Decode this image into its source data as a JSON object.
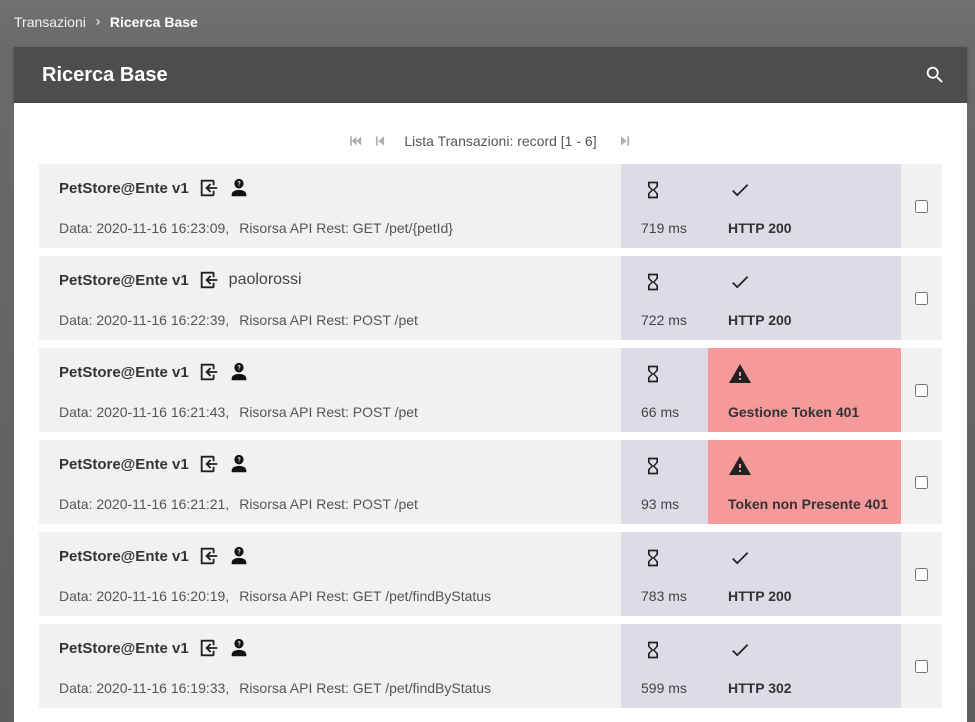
{
  "breadcrumb": {
    "items": [
      {
        "label": "Transazioni"
      },
      {
        "label": "Ricerca Base"
      }
    ]
  },
  "panel": {
    "title": "Ricerca Base",
    "search_icon": "search-icon"
  },
  "pager": {
    "label": "Lista Transazioni: record [1 - 6]",
    "first_icon": "first-page-icon",
    "prev_icon": "prev-page-icon",
    "last_icon": "last-page-icon"
  },
  "colors": {
    "header_bg": "#4d4d4d",
    "row_bg": "#f1f1f1",
    "status_ok_bg": "#dcdce6",
    "status_error_bg": "#f5999b"
  },
  "transactions": [
    {
      "api": "PetStore@Ente v1",
      "principal": "",
      "date": "Data: 2020-11-16 16:23:09,",
      "resource": "Risorsa API Rest: GET /pet/{petId}",
      "latency": "719 ms",
      "status": "HTTP 200",
      "status_type": "ok",
      "direction_icon": "inbound-icon",
      "user_icon": "anonymous-user-icon",
      "status_icon": "check-icon"
    },
    {
      "api": "PetStore@Ente v1",
      "principal": "paolorossi",
      "date": "Data: 2020-11-16 16:22:39,",
      "resource": "Risorsa API Rest: POST /pet",
      "latency": "722 ms",
      "status": "HTTP 200",
      "status_type": "ok",
      "direction_icon": "inbound-icon",
      "user_icon": "",
      "status_icon": "check-icon"
    },
    {
      "api": "PetStore@Ente v1",
      "principal": "",
      "date": "Data: 2020-11-16 16:21:43,",
      "resource": "Risorsa API Rest: POST /pet",
      "latency": "66 ms",
      "status": "Gestione Token 401",
      "status_type": "error",
      "direction_icon": "inbound-icon",
      "user_icon": "anonymous-user-icon",
      "status_icon": "warning-icon"
    },
    {
      "api": "PetStore@Ente v1",
      "principal": "",
      "date": "Data: 2020-11-16 16:21:21,",
      "resource": "Risorsa API Rest: POST /pet",
      "latency": "93 ms",
      "status": "Token non Presente 401",
      "status_type": "error",
      "direction_icon": "inbound-icon",
      "user_icon": "anonymous-user-icon",
      "status_icon": "warning-icon"
    },
    {
      "api": "PetStore@Ente v1",
      "principal": "",
      "date": "Data: 2020-11-16 16:20:19,",
      "resource": "Risorsa API Rest: GET /pet/findByStatus",
      "latency": "783 ms",
      "status": "HTTP 200",
      "status_type": "ok",
      "direction_icon": "inbound-icon",
      "user_icon": "anonymous-user-icon",
      "status_icon": "check-icon"
    },
    {
      "api": "PetStore@Ente v1",
      "principal": "",
      "date": "Data: 2020-11-16 16:19:33,",
      "resource": "Risorsa API Rest: GET /pet/findByStatus",
      "latency": "599 ms",
      "status": "HTTP 302",
      "status_type": "ok",
      "direction_icon": "inbound-icon",
      "user_icon": "anonymous-user-icon",
      "status_icon": "check-icon"
    }
  ]
}
